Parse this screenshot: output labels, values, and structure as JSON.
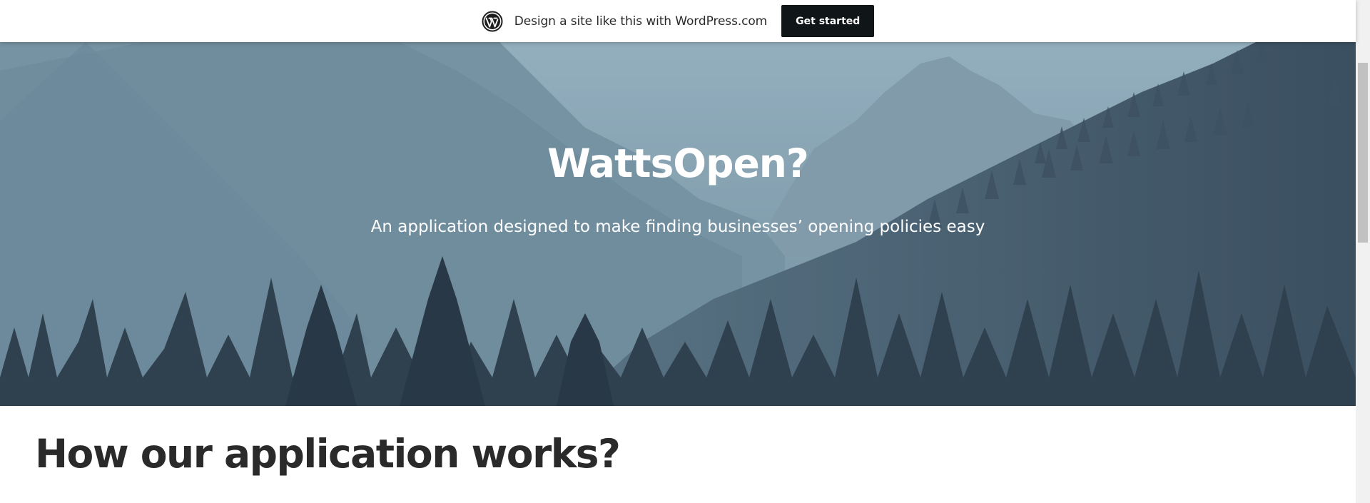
{
  "promo_bar": {
    "logo_icon": "wordpress-logo-icon",
    "text": "Design a site like this with WordPress.com",
    "button_label": "Get started"
  },
  "hero": {
    "title": "WattsOpen?",
    "subtitle": "An application designed to make finding businesses’ opening policies easy",
    "background_image": "mountain-forest-landscape"
  },
  "main": {
    "heading": "How our application works?"
  },
  "colors": {
    "promo_button_bg": "#101517",
    "hero_overlay": "#7c9aa9",
    "heading_text": "#2a2a2a"
  }
}
